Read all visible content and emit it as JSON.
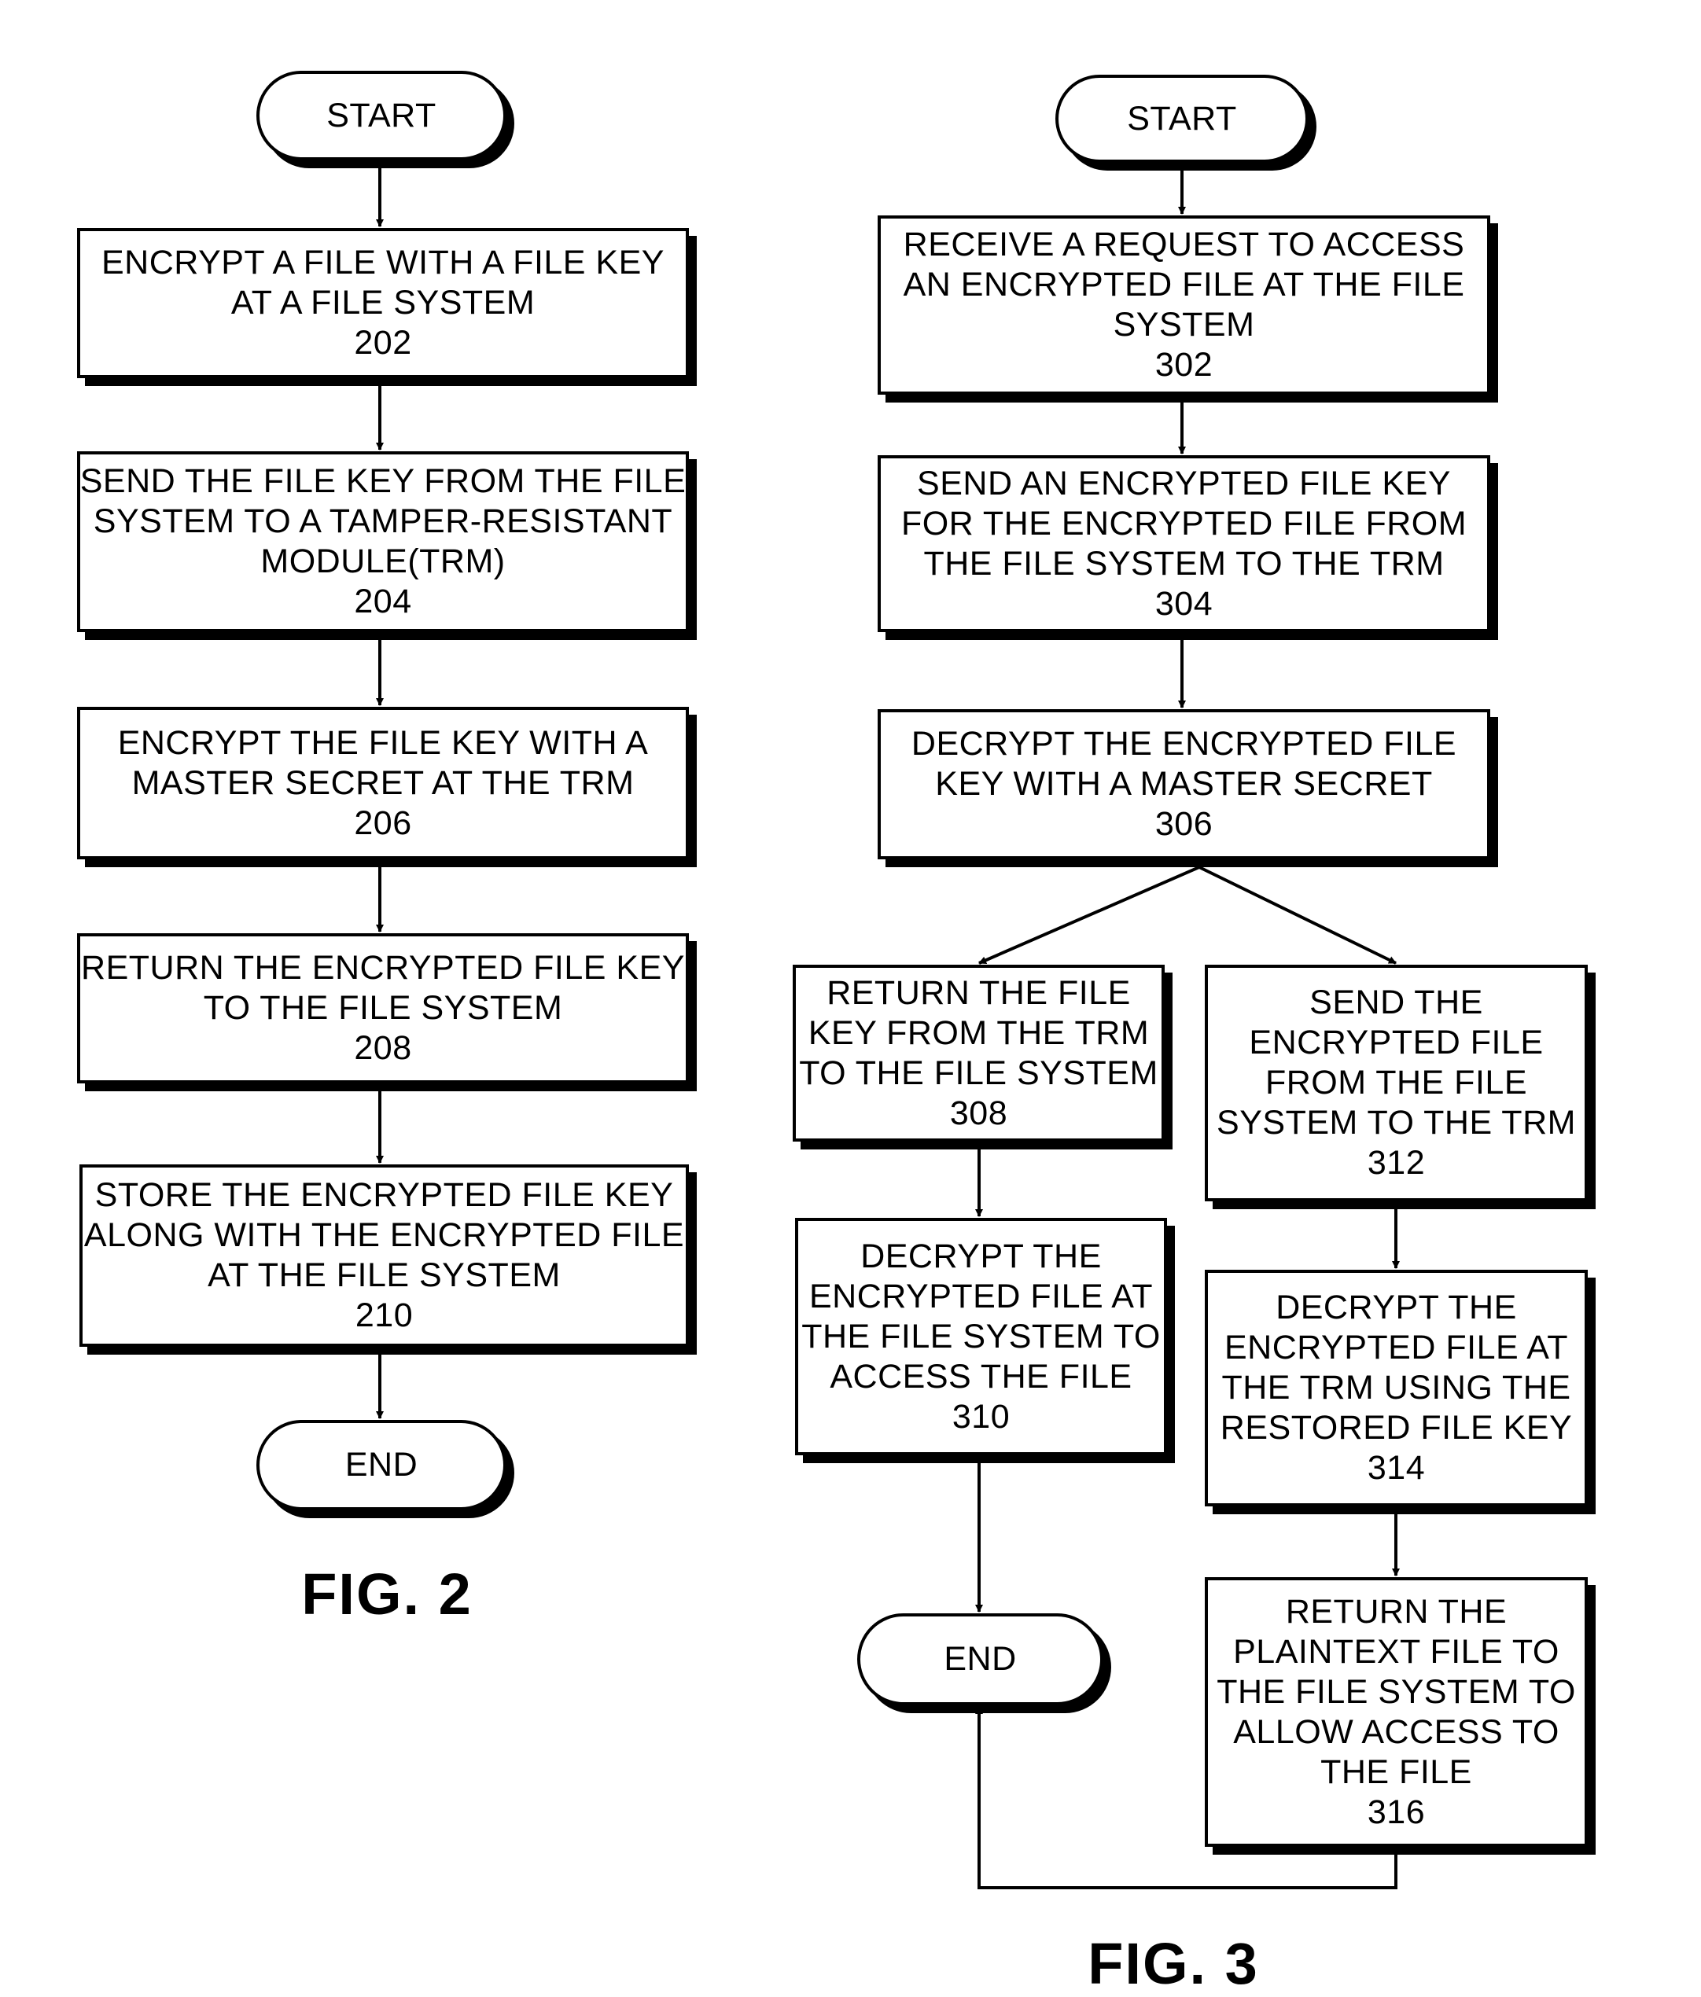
{
  "fig2": {
    "caption": "FIG. 2",
    "start": "START",
    "end": "END",
    "steps": [
      {
        "lines": [
          "ENCRYPT A FILE WITH A FILE KEY",
          "AT A FILE SYSTEM"
        ],
        "ref": "202"
      },
      {
        "lines": [
          "SEND THE FILE KEY FROM THE FILE",
          "SYSTEM TO A TAMPER-RESISTANT",
          "MODULE(TRM)"
        ],
        "ref": "204"
      },
      {
        "lines": [
          "ENCRYPT THE FILE KEY WITH A",
          "MASTER SECRET AT THE TRM"
        ],
        "ref": "206"
      },
      {
        "lines": [
          "RETURN THE ENCRYPTED FILE KEY",
          "TO THE FILE SYSTEM"
        ],
        "ref": "208"
      },
      {
        "lines": [
          "STORE THE ENCRYPTED FILE KEY",
          "ALONG WITH THE ENCRYPTED FILE",
          "AT THE FILE SYSTEM"
        ],
        "ref": "210"
      }
    ]
  },
  "fig3": {
    "caption": "FIG. 3",
    "start": "START",
    "end": "END",
    "steps": {
      "s302": {
        "lines": [
          "RECEIVE A REQUEST TO ACCESS",
          "AN ENCRYPTED FILE AT THE FILE",
          "SYSTEM"
        ],
        "ref": "302"
      },
      "s304": {
        "lines": [
          "SEND AN ENCRYPTED FILE KEY",
          "FOR THE ENCRYPTED FILE FROM",
          "THE FILE SYSTEM TO THE TRM"
        ],
        "ref": "304"
      },
      "s306": {
        "lines": [
          "DECRYPT THE ENCRYPTED FILE",
          "KEY WITH A MASTER SECRET"
        ],
        "ref": "306"
      },
      "s308": {
        "lines": [
          "RETURN THE FILE",
          "KEY FROM THE TRM",
          "TO THE FILE SYSTEM"
        ],
        "ref": "308"
      },
      "s310": {
        "lines": [
          "DECRYPT THE",
          "ENCRYPTED FILE AT",
          "THE FILE SYSTEM TO",
          "ACCESS THE FILE"
        ],
        "ref": "310"
      },
      "s312": {
        "lines": [
          "SEND THE",
          "ENCRYPTED FILE",
          "FROM THE FILE",
          "SYSTEM TO THE TRM"
        ],
        "ref": "312"
      },
      "s314": {
        "lines": [
          "DECRYPT THE",
          "ENCRYPTED FILE AT",
          "THE TRM USING THE",
          "RESTORED FILE KEY"
        ],
        "ref": "314"
      },
      "s316": {
        "lines": [
          "RETURN THE",
          "PLAINTEXT FILE TO",
          "THE FILE SYSTEM TO",
          "ALLOW ACCESS TO",
          "THE FILE"
        ],
        "ref": "316"
      }
    }
  }
}
